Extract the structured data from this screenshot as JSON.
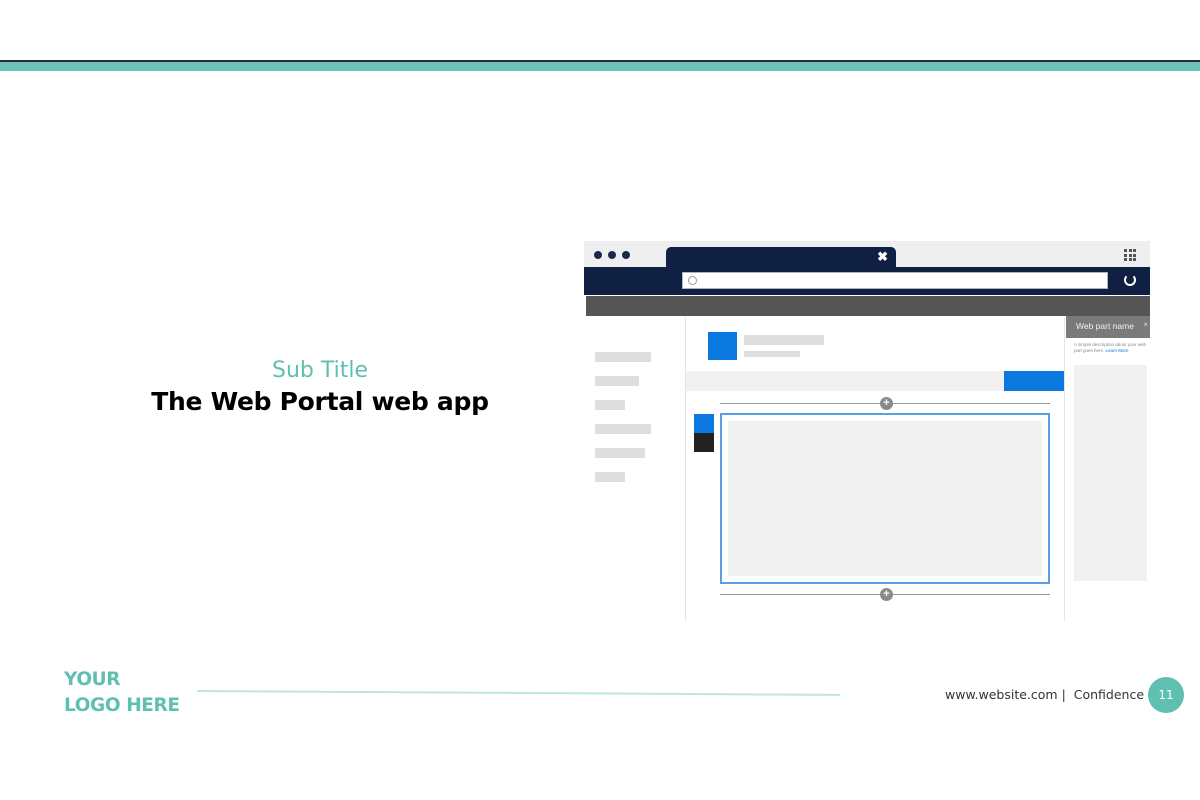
{
  "slide": {
    "sub_title": "Sub Title",
    "title": "The Web Portal web app"
  },
  "mockup": {
    "tab_close": "✖",
    "panel_title": "Web part name",
    "panel_close": "×",
    "panel_description": "A simple description about your web part goes here.",
    "panel_link": "Learn More",
    "plus_symbol": "+"
  },
  "footer": {
    "logo_line1": "YOUR",
    "logo_line2": "LOGO HERE",
    "website": "www.website.com",
    "separator": "|",
    "confidence": "Confidence",
    "page_number": "11"
  },
  "colors": {
    "accent": "#5fbfb0",
    "navy": "#0f2043",
    "blue": "#0b78e0"
  }
}
